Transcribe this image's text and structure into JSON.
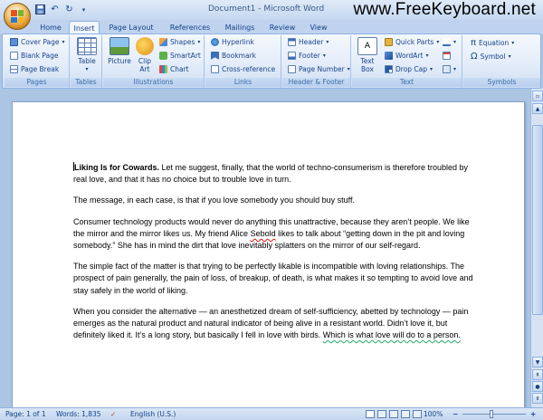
{
  "window": {
    "title": "Document1 - Microsoft Word",
    "watermark": "www.FreeKeyboard.net"
  },
  "tabs": [
    "Home",
    "Insert",
    "Page Layout",
    "References",
    "Mailings",
    "Review",
    "View"
  ],
  "active_tab": "Insert",
  "ribbon": {
    "pages": {
      "label": "Pages",
      "items": [
        "Cover Page",
        "Blank Page",
        "Page Break"
      ]
    },
    "tables": {
      "label": "Tables",
      "items": [
        "Table"
      ]
    },
    "illustrations": {
      "label": "Illustrations",
      "picture": "Picture",
      "clip_art": "Clip Art",
      "shapes": "Shapes",
      "smartart": "SmartArt",
      "chart": "Chart"
    },
    "links": {
      "label": "Links",
      "items": [
        "Hyperlink",
        "Bookmark",
        "Cross-reference"
      ]
    },
    "header_footer": {
      "label": "Header & Footer",
      "items": [
        "Header",
        "Footer",
        "Page Number"
      ]
    },
    "text": {
      "label": "Text",
      "text_box": "Text Box",
      "items": [
        "Quick Parts",
        "WordArt",
        "Drop Cap"
      ]
    },
    "symbols": {
      "label": "Symbols",
      "items": [
        "Equation",
        "Symbol"
      ]
    }
  },
  "document": {
    "p1_bold": "Liking Is for Cowards.",
    "p1_rest": " Let me suggest, finally, that the world of techno-consumerism is therefore troubled by real love, and that it has no choice but to trouble love in turn.",
    "p2": "The message, in each case, is that if you love somebody you should buy stuff.",
    "p3_a": "Consumer technology products would never do anything this unattractive, because they aren’t people. We like the mirror and the mirror likes us. My friend Alice ",
    "p3_squig": "Sebold",
    "p3_b": " likes to talk about “getting down in the pit and loving somebody.” She has in mind the dirt that love inevitably splatters on the mirror of our self-regard.",
    "p4": "The simple fact of the matter is that trying to be perfectly likable is incompatible with loving relationships. The prospect of pain generally, the pain of loss, of breakup, of death, is what makes it so tempting to avoid love and stay safely in the world of liking.",
    "p5_a": "When you consider the alternative — an anesthetized dream of self-sufficiency, abetted by technology — pain emerges as the natural product and natural indicator of being alive in a resistant world. Didn’t love it, but definitely liked it. It’s a long story, but basically I fell in love with birds. ",
    "p5_grammar": "Which is what love will do to a person."
  },
  "status": {
    "page": "Page: 1 of 1",
    "words": "Words: 1,835",
    "language": "English (U.S.)",
    "zoom": "100%",
    "zoom_level": 1.0
  },
  "colors": {
    "accent": "#15428b",
    "ribbon_border": "#8db2e3"
  }
}
